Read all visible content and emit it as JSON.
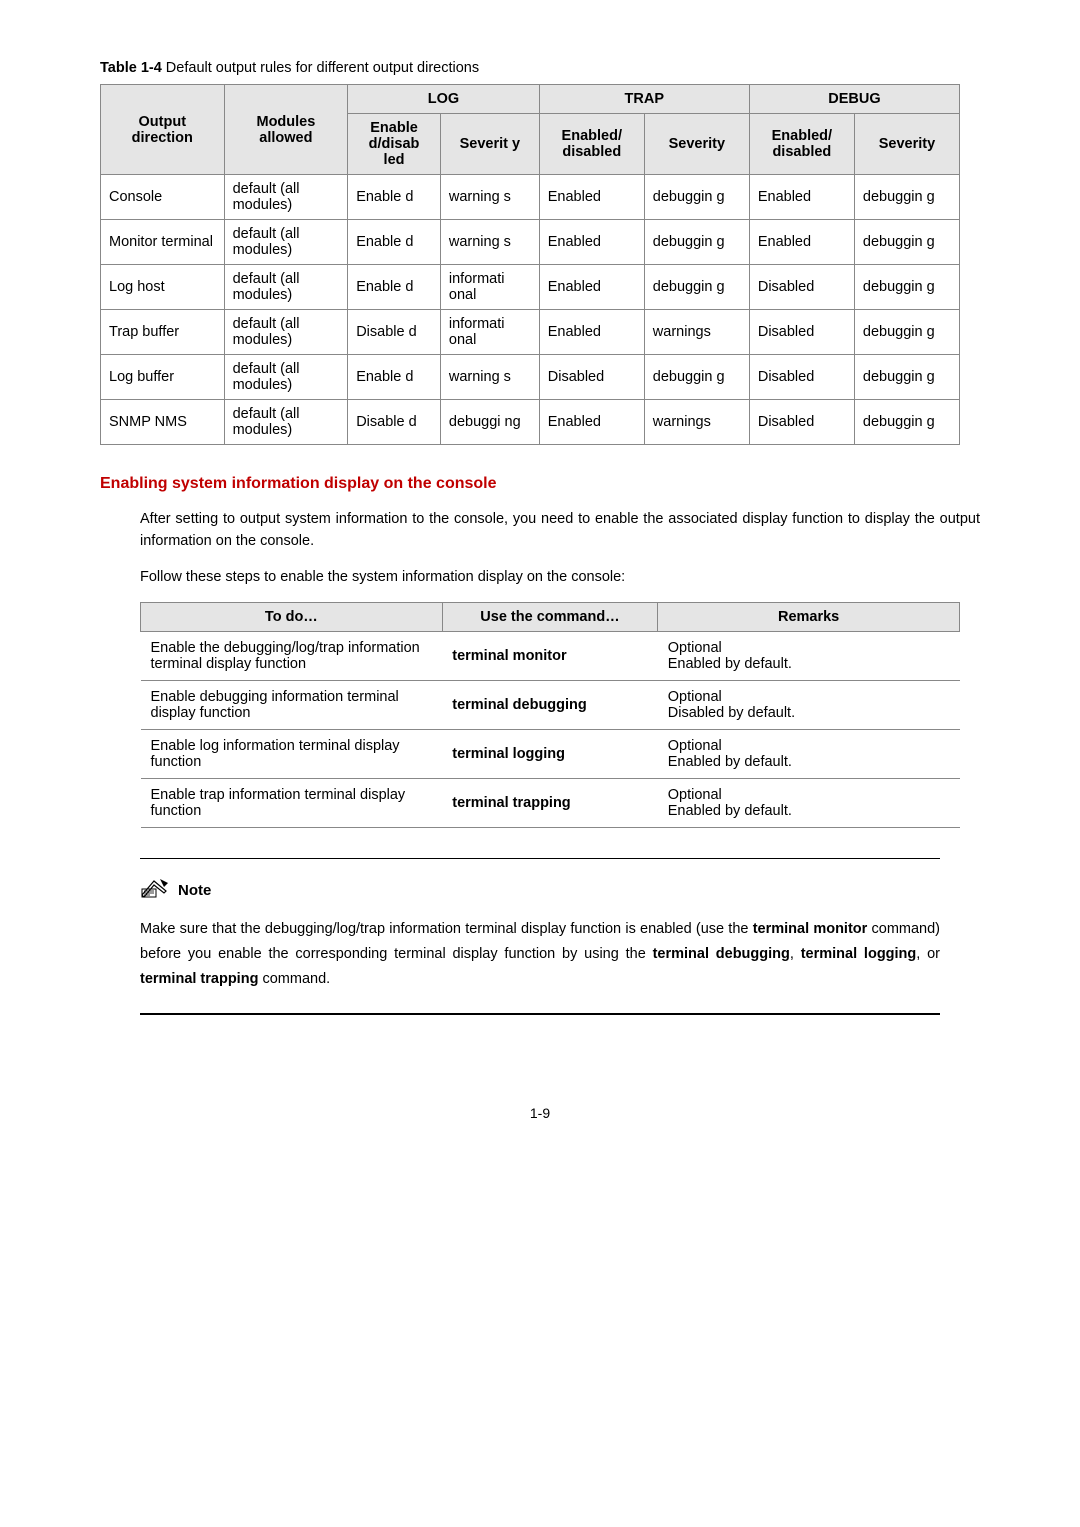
{
  "table1": {
    "caption_bold": "Table 1-4",
    "caption_rest": " Default output rules for different output directions",
    "headers": {
      "col_output": "Output direction",
      "col_modules": "Modules allowed",
      "grp_log": "LOG",
      "grp_trap": "TRAP",
      "grp_debug": "DEBUG",
      "col_enable": "Enable d/disab led",
      "col_severity1": "Severit y",
      "col_enabled2": "Enabled/ disabled",
      "col_severity2": "Severity",
      "col_enabled3": "Enabled/ disabled",
      "col_severity3": "Severity"
    },
    "rows": [
      {
        "out": "Console",
        "mod": "default (all modules)",
        "en1": "Enable d",
        "sev1": "warning s",
        "en2": "Enabled",
        "sev2": "debuggin g",
        "en3": "Enabled",
        "sev3": "debuggin g"
      },
      {
        "out": "Monitor terminal",
        "mod": "default (all modules)",
        "en1": "Enable d",
        "sev1": "warning s",
        "en2": "Enabled",
        "sev2": "debuggin g",
        "en3": "Enabled",
        "sev3": "debuggin g"
      },
      {
        "out": "Log host",
        "mod": "default (all modules)",
        "en1": "Enable d",
        "sev1": "informati onal",
        "en2": "Enabled",
        "sev2": "debuggin g",
        "en3": "Disabled",
        "sev3": "debuggin g"
      },
      {
        "out": "Trap buffer",
        "mod": "default (all modules)",
        "en1": "Disable d",
        "sev1": "informati onal",
        "en2": "Enabled",
        "sev2": "warnings",
        "en3": "Disabled",
        "sev3": "debuggin g"
      },
      {
        "out": "Log buffer",
        "mod": "default (all modules)",
        "en1": "Enable d",
        "sev1": "warning s",
        "en2": "Disabled",
        "sev2": "debuggin g",
        "en3": "Disabled",
        "sev3": "debuggin g"
      },
      {
        "out": "SNMP NMS",
        "mod": "default (all modules)",
        "en1": "Disable d",
        "sev1": "debuggi ng",
        "en2": "Enabled",
        "sev2": "warnings",
        "en3": "Disabled",
        "sev3": "debuggin g"
      }
    ]
  },
  "section_heading": "Enabling system information display on the console",
  "para1": "After setting to output system information to the console, you need to enable the associated display function to display the output information on the console.",
  "para2": "Follow these steps to enable the system information display on the console:",
  "table2": {
    "headers": {
      "todo": "To do…",
      "cmd": "Use the command…",
      "remarks": "Remarks"
    },
    "rows": [
      {
        "todo": "Enable the debugging/log/trap information terminal display function",
        "cmd": "terminal monitor",
        "rem1": "Optional",
        "rem2": "Enabled by default."
      },
      {
        "todo": "Enable debugging information terminal display function",
        "cmd": "terminal debugging",
        "rem1": "Optional",
        "rem2": "Disabled by default."
      },
      {
        "todo": "Enable log information terminal display function",
        "cmd": "terminal logging",
        "rem1": "Optional",
        "rem2": "Enabled by default."
      },
      {
        "todo": "Enable trap information terminal display function",
        "cmd": "terminal trapping",
        "rem1": "Optional",
        "rem2": "Enabled by default."
      }
    ]
  },
  "note": {
    "label": "Note",
    "text_before": "Make sure that the debugging/log/trap information terminal display function is enabled (use the ",
    "b1": "terminal monitor",
    "text_mid1": " command) before you enable the corresponding terminal display function by using the ",
    "b2": "terminal debugging",
    "sep1": ", ",
    "b3": "terminal logging",
    "sep2": ", or ",
    "b4": "terminal trapping",
    "text_after": " command."
  },
  "page_number": "1-9"
}
